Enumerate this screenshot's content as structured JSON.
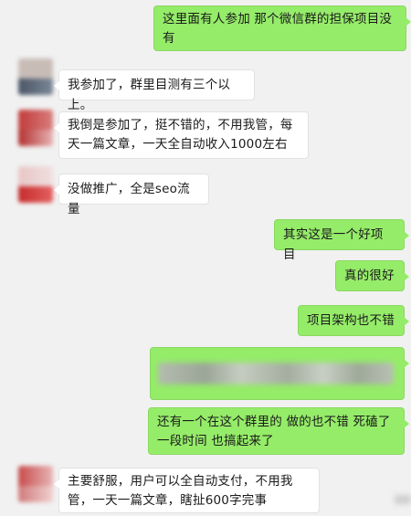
{
  "messages": [
    {
      "side": "out",
      "text": "这里面有人参加 那个微信群的担保项目没有"
    },
    {
      "side": "in",
      "text": "我参加了，群里目测有三个以上。"
    },
    {
      "side": "in",
      "text": "我倒是参加了，挺不错的，不用我管，每天一篇文章，一天全自动收入1000左右"
    },
    {
      "side": "in",
      "text": "没做推广，全是seo流量"
    },
    {
      "side": "out",
      "text": "其实这是一个好项目"
    },
    {
      "side": "out",
      "text": "真的很好"
    },
    {
      "side": "out",
      "text": "项目架构也不错"
    },
    {
      "side": "out",
      "text": ""
    },
    {
      "side": "out",
      "text": "还有一个在这个群里的 做的也不错 死磕了一段时间 也搞起来了"
    },
    {
      "side": "in",
      "text": "主要舒服，用户可以全自动支付，不用我管，一天一篇文章，瞎扯600字完事"
    }
  ],
  "colors": {
    "background": "#f1f1f1",
    "outgoing_bubble": "#95ec69",
    "incoming_bubble": "#ffffff"
  }
}
